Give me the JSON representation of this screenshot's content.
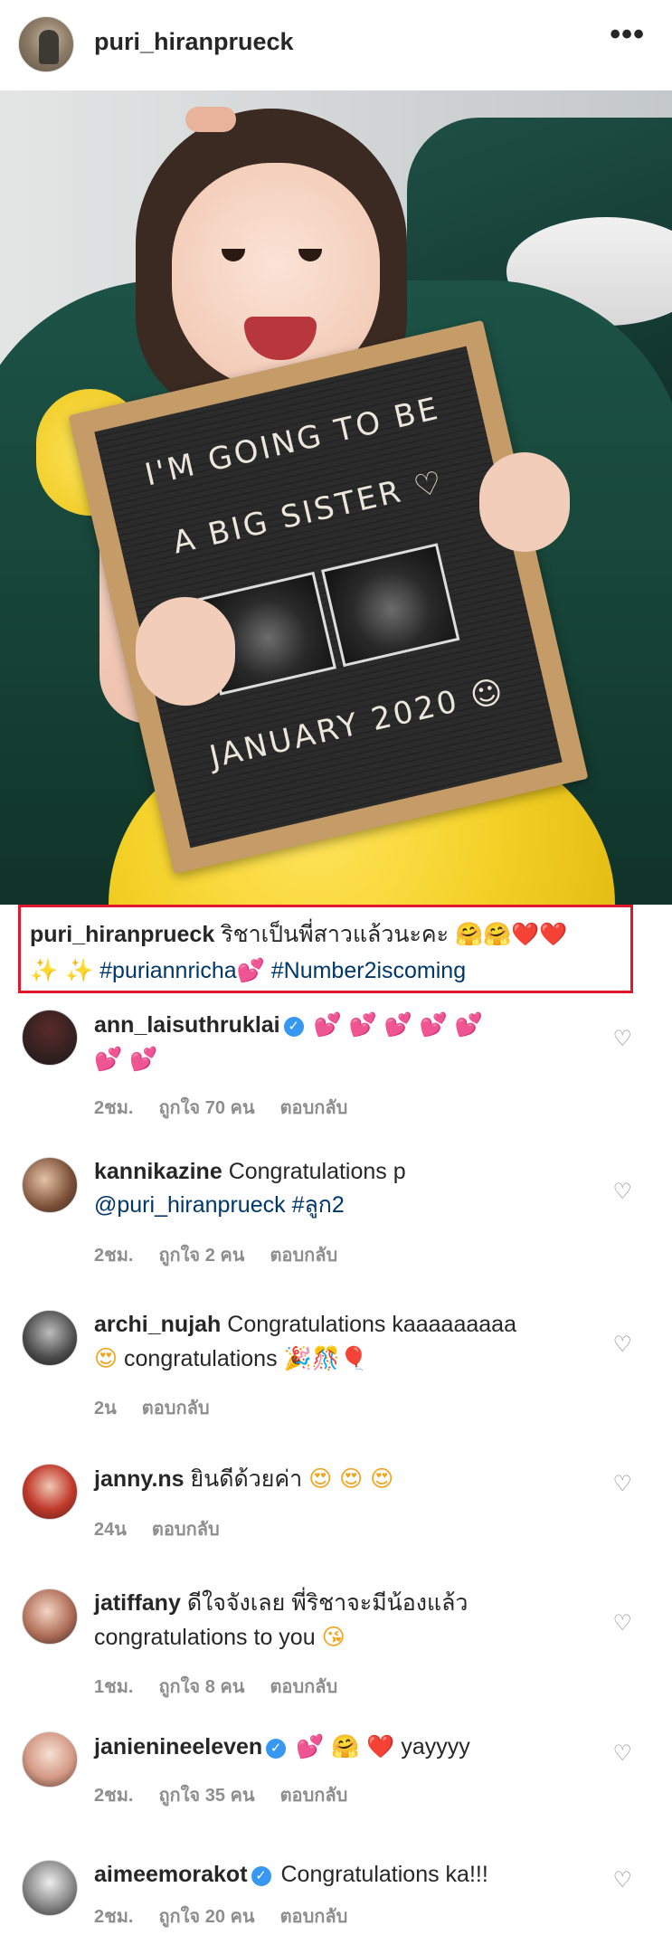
{
  "header": {
    "username": "puri_hiranprueck",
    "more_glyph": "•••"
  },
  "photo": {
    "board_line1": "I'M GOING TO BE",
    "board_line2": "A BIG SISTER ♡",
    "board_line3": "JANUARY 2020 ☺"
  },
  "caption": {
    "username": "puri_hiranprueck",
    "text": "ริชาเป็นพี่สาวแล้วนะคะ",
    "emojis1": "🤗🤗❤️❤️",
    "sparkles": "✨ ✨",
    "hashtag1": "#puriannricha",
    "hashtag1_emoji": "💕",
    "hashtag2": "#Number2iscoming"
  },
  "colors": {
    "link": "#00376b",
    "highlight_border": "#e0182d",
    "verified": "#3897f0",
    "meta": "#8e8e8e"
  },
  "comments": [
    {
      "username": "ann_laisuthruklai",
      "verified": true,
      "text": "",
      "emoji_line1": "💕 💕 💕 💕 💕",
      "emoji_line2": "💕 💕",
      "time": "2ชม.",
      "likes": "ถูกใจ 70 คน",
      "reply": "ตอบกลับ"
    },
    {
      "username": "kannikazine",
      "verified": false,
      "text": "Congratulations p",
      "mention": "@puri_hiranprueck",
      "hashtag": "#ลูก2",
      "time": "2ชม.",
      "likes": "ถูกใจ 2 คน",
      "reply": "ตอบกลับ"
    },
    {
      "username": "archi_nujah",
      "verified": false,
      "text": "Congratulations kaaaaaaaaa",
      "line2_emoji": "😍",
      "line2_text": "congratulations",
      "line2_emojis": "🎉🎊🎈",
      "time": "2น",
      "likes": "",
      "reply": "ตอบกลับ"
    },
    {
      "username": "janny.ns",
      "verified": false,
      "text": "ยินดีด้วยค่า",
      "emojis": "😍 😍 😍",
      "time": "24น",
      "likes": "",
      "reply": "ตอบกลับ"
    },
    {
      "username": "jatiffany",
      "verified": false,
      "text": "ดีใจจังเลย พี่ริชาจะมีน้องแล้ว",
      "line2_text": "congratulations to you",
      "line2_emoji": "😘",
      "time": "1ชม.",
      "likes": "ถูกใจ 8 คน",
      "reply": "ตอบกลับ"
    },
    {
      "username": "janienineeleven",
      "verified": true,
      "emojis": "💕 🤗 ❤️",
      "text": "yayyyy",
      "time": "2ชม.",
      "likes": "ถูกใจ 35 คน",
      "reply": "ตอบกลับ"
    },
    {
      "username": "aimeemorakot",
      "verified": true,
      "text": "Congratulations ka!!!",
      "time": "2ชม.",
      "likes": "ถูกใจ 20 คน",
      "reply": "ตอบกลับ"
    }
  ],
  "icons": {
    "heart": "♡",
    "verified": "✓"
  }
}
